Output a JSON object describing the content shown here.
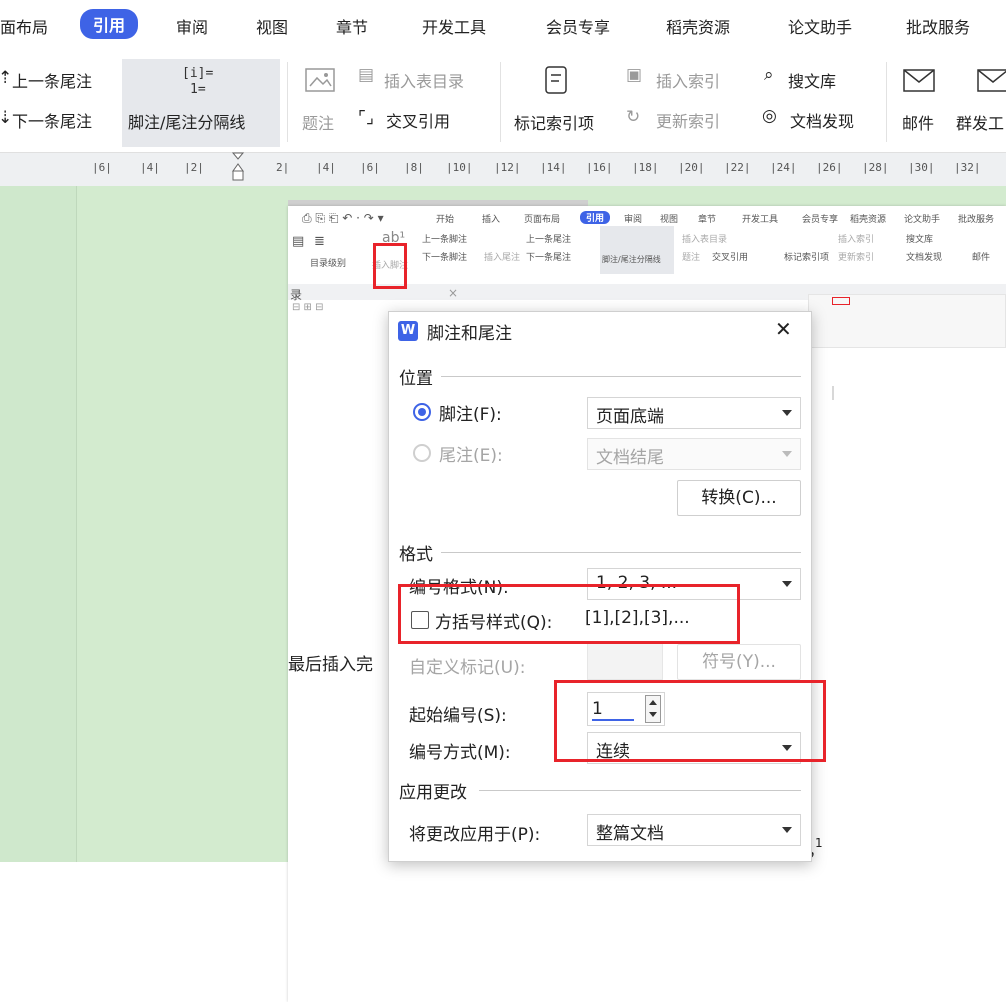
{
  "ribbon": {
    "tabs": [
      "面布局",
      "引用",
      "审阅",
      "视图",
      "章节",
      "开发工具",
      "会员专享",
      "稻壳资源",
      "论文助手",
      "批改服务"
    ],
    "active_tab": "引用",
    "prev_endnote": "上一条尾注",
    "next_endnote": "下一条尾注",
    "separator_label": "脚注/尾注分隔线",
    "insert_toc": "插入表目录",
    "caption": "题注",
    "cross_ref": "交叉引用",
    "mark_index": "标记索引项",
    "insert_index": "插入索引",
    "update_index": "更新索引",
    "search_lib": "搜文库",
    "doc_discover": "文档发现",
    "mail": "邮件",
    "group_send": "群发工"
  },
  "ruler": {
    "ticks": [
      "6",
      "4",
      "2",
      "2",
      "4",
      "6",
      "8",
      "10",
      "12",
      "14",
      "16",
      "18",
      "20",
      "22",
      "24",
      "26",
      "28",
      "30",
      "32"
    ]
  },
  "inner_shot": {
    "tabs": [
      "开始",
      "插入",
      "页面布局",
      "引用",
      "审阅",
      "视图",
      "章节",
      "开发工具",
      "会员专享",
      "稻壳资源",
      "论文助手",
      "批改服务"
    ],
    "toc_level": "目录级别",
    "insert_footnote": "插入脚注",
    "prev_footnote": "上一条脚注",
    "next_footnote": "下一条脚注",
    "insert_endnote": "插入尾注",
    "prev_endnote": "上一条尾注",
    "next_endnote": "下一条尾注",
    "separator": "脚注/尾注分隔线",
    "insert_toc": "插入表目录",
    "caption": "题注",
    "cross_ref": "交叉引用",
    "mark_index": "标记索引项",
    "insert_index": "插入索引",
    "update_index": "更新索引",
    "search_lib": "搜文库",
    "doc_discover": "文档发现",
    "mail": "邮件",
    "nav_label": "录"
  },
  "dialog": {
    "title": "脚注和尾注",
    "location_group": "位置",
    "footnote_label": "脚注(F):",
    "footnote_pos": "页面底端",
    "endnote_label": "尾注(E):",
    "endnote_pos": "文档结尾",
    "convert": "转换(C)...",
    "format_group": "格式",
    "numfmt_label": "编号格式(N):",
    "numfmt_value": "1, 2, 3, ...",
    "bracket_label": "方括号样式(Q):",
    "bracket_example": "[1],[2],[3],...",
    "custom_mark_label": "自定义标记(U):",
    "symbol_btn": "符号(Y)...",
    "start_label": "起始编号(S):",
    "start_value": "1",
    "numbering_label": "编号方式(M):",
    "numbering_value": "连续",
    "apply_group": "应用更改",
    "apply_label": "将更改应用于(P):",
    "apply_value": "整篇文档"
  },
  "document": {
    "body_text": "最后插入完",
    "body_tail": "，",
    "superscript": "1"
  },
  "colors": {
    "accent": "#3e63e6",
    "highlight": "#e8232a",
    "page_green": "#d3ebcf"
  }
}
